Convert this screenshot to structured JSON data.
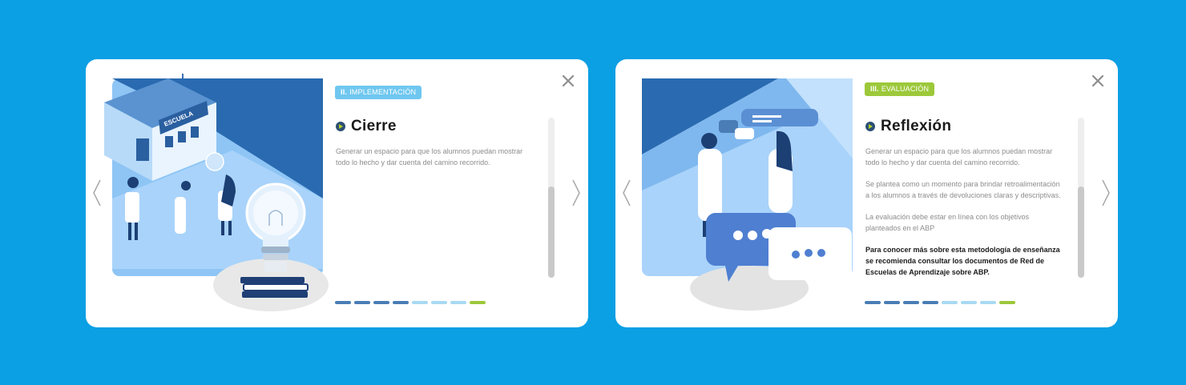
{
  "colors": {
    "background": "#0b9fe4",
    "progress_done": "#4a7db5",
    "progress_todo": "#a9d9f2",
    "progress_current": "#9cc83a",
    "badge_implementation": "#6fc7f0",
    "badge_evaluation": "#9cc83a"
  },
  "icons": {
    "close": "close-icon",
    "prev": "chevron-left-icon",
    "next": "chevron-right-icon",
    "heading": "arrow-circle-icon"
  },
  "cards": [
    {
      "badge": {
        "number": "II.",
        "text": "IMPLEMENTACIÓN"
      },
      "title": "Cierre",
      "illustration_label": "ESCUELA",
      "paragraphs": [
        "Generar un espacio para que los alumnos puedan mostrar todo lo hecho y dar cuenta del camino recorrido."
      ],
      "progress": {
        "completed_steps": 4,
        "total_steps": 8,
        "current_step": 8
      }
    },
    {
      "badge": {
        "number": "III.",
        "text": "EVALUACIÓN"
      },
      "title": "Reflexión",
      "paragraphs": [
        "Generar un espacio para que los alumnos puedan mostrar todo lo hecho y dar cuenta del camino recorrido.",
        "Se plantea como un momento para brindar retroalimentación a los alumnos a través de devoluciones claras y descriptivas.",
        "La evaluación debe estar en línea con los objetivos planteados en el ABP"
      ],
      "note": "Para conocer más sobre esta metodología de enseñanza se recomienda consultar los documentos de Red de Escuelas de Aprendizaje sobre ABP.",
      "progress": {
        "completed_steps": 4,
        "total_steps": 8,
        "current_step": 8
      }
    }
  ]
}
